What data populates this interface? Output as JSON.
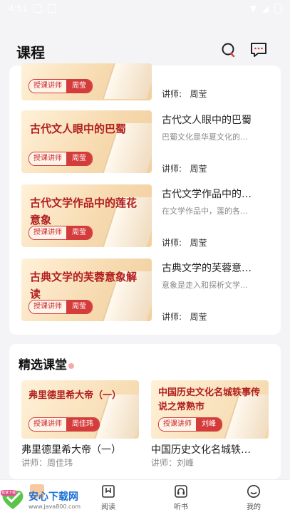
{
  "status": {
    "time": "4:51"
  },
  "header": {
    "title": "课程"
  },
  "courses": [
    {
      "thumb_title": "",
      "badge_label": "授课讲师",
      "badge_name": "周莹",
      "name": "",
      "desc": "",
      "teacher_label": "讲师:",
      "teacher_name": "周莹"
    },
    {
      "thumb_title": "古代文人眼中的巴蜀",
      "badge_label": "授课讲师",
      "badge_name": "周莹",
      "name": "古代文人眼中的巴蜀",
      "desc": "巴蜀文化是华夏文化的…",
      "teacher_label": "讲师:",
      "teacher_name": "周莹"
    },
    {
      "thumb_title": "古代文学作品中的莲花意象",
      "badge_label": "授课讲师",
      "badge_name": "周莹",
      "name": "古代文学作品中的…",
      "desc": "在文学作品中，莲的各…",
      "teacher_label": "讲师:",
      "teacher_name": "周莹"
    },
    {
      "thumb_title": "古典文学的芙蓉意象解读",
      "badge_label": "授课讲师",
      "badge_name": "周莹",
      "name": "古典文学的芙蓉意…",
      "desc": "意象是走入和探析文学…",
      "teacher_label": "讲师:",
      "teacher_name": "周莹"
    }
  ],
  "featured": {
    "title": "精选课堂",
    "items": [
      {
        "thumb_title": "弗里德里希大帝（一）",
        "badge_label": "授课讲师",
        "badge_name": "周佳玮",
        "name": "弗里德里希大帝（一）",
        "teacher": "讲师：周佳玮"
      },
      {
        "thumb_title": "中国历史文化名城轶事传说之常熟市",
        "badge_label": "授课讲师",
        "badge_name": "刘峰",
        "name": "中国历史文化名城轶…",
        "teacher": "讲师：刘峰"
      }
    ]
  },
  "tabs": [
    {
      "label": ""
    },
    {
      "label": "阅读"
    },
    {
      "label": "听书"
    },
    {
      "label": "我的"
    }
  ],
  "watermark": {
    "brand": "安心下载网",
    "url": "www.java800.com",
    "badge": "极速下载"
  }
}
